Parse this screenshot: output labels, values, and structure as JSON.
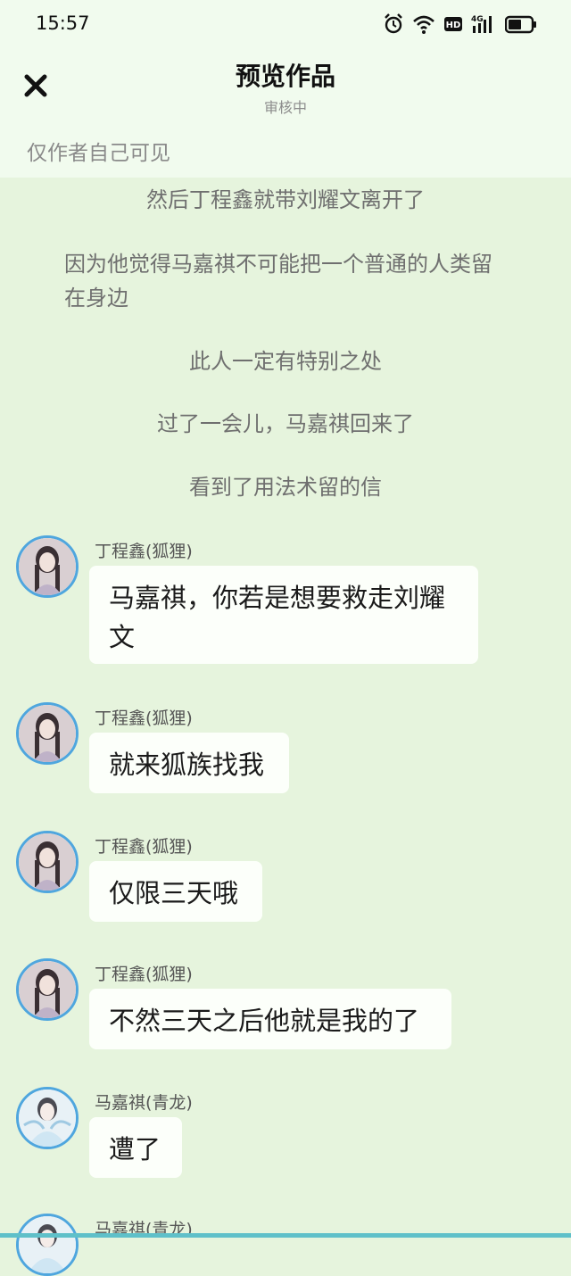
{
  "status": {
    "time": "15:57",
    "icons": [
      "alarm-icon",
      "wifi-icon",
      "hd-icon",
      "signal-4g-icon",
      "battery-icon"
    ],
    "hd_label": "HD",
    "net_label": "4G"
  },
  "header": {
    "title": "预览作品",
    "subtitle": "审核中",
    "visibility_note": "仅作者自己可见"
  },
  "narration": [
    "然后丁程鑫就带刘耀文离开了",
    "因为他觉得马嘉祺不可能把一个普通的人类留在身边",
    "此人一定有特别之处",
    "过了一会儿，马嘉祺回来了",
    "看到了用法术留的信"
  ],
  "messages": [
    {
      "speaker": "丁程鑫(狐狸)",
      "text": "马嘉祺，你若是想要救走刘耀文"
    },
    {
      "speaker": "丁程鑫(狐狸)",
      "text": "就来狐族找我"
    },
    {
      "speaker": "丁程鑫(狐狸)",
      "text": "仅限三天哦"
    },
    {
      "speaker": "丁程鑫(狐狸)",
      "text": "不然三天之后他就是我的了"
    },
    {
      "speaker": "马嘉祺(青龙)",
      "text": "遭了"
    },
    {
      "speaker": "马嘉祺(青龙)",
      "text": ""
    }
  ],
  "colors": {
    "background": "#e6f4dd",
    "header_bg": "#f1fbee",
    "bubble": "#fcfffa",
    "avatar_ring": "#4fa6de"
  }
}
